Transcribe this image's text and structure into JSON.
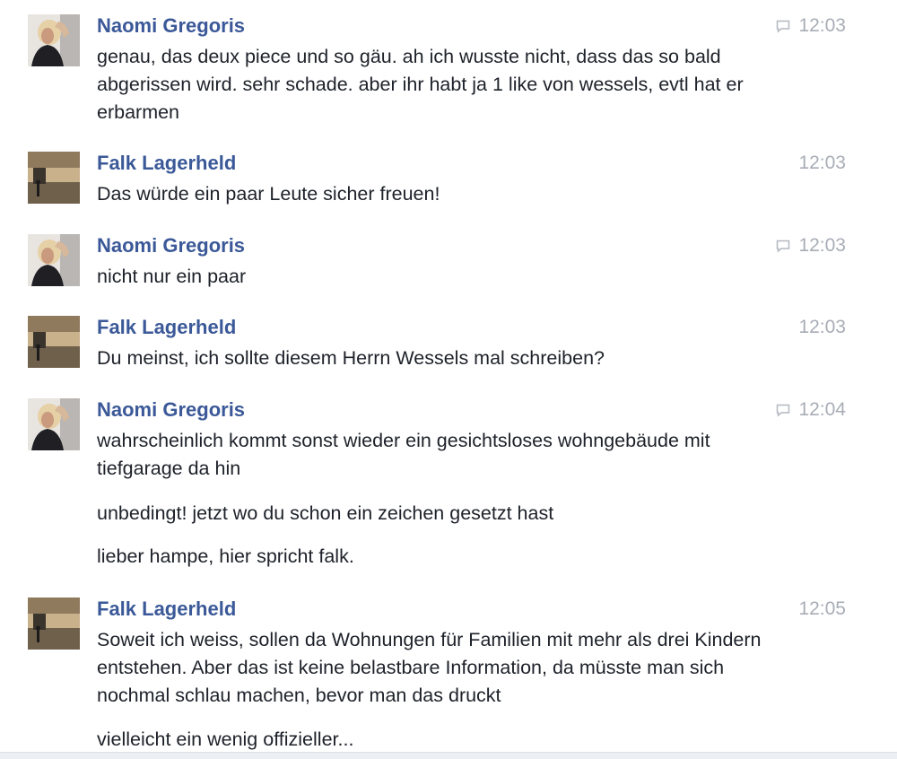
{
  "messages": [
    {
      "sender": "Naomi Gregoris",
      "time": "12:03",
      "has_comment_icon": true,
      "paragraphs": [
        "genau, das deux piece und so gäu. ah ich wusste nicht, dass das so bald abgerissen wird. sehr schade. aber ihr habt ja 1 like von wessels, evtl hat er erbarmen"
      ]
    },
    {
      "sender": "Falk Lagerheld",
      "time": "12:03",
      "has_comment_icon": false,
      "paragraphs": [
        "Das würde ein paar Leute sicher freuen!"
      ]
    },
    {
      "sender": "Naomi Gregoris",
      "time": "12:03",
      "has_comment_icon": true,
      "paragraphs": [
        "nicht nur ein paar"
      ]
    },
    {
      "sender": "Falk Lagerheld",
      "time": "12:03",
      "has_comment_icon": false,
      "paragraphs": [
        "Du meinst, ich sollte diesem Herrn Wessels mal schreiben?"
      ]
    },
    {
      "sender": "Naomi Gregoris",
      "time": "12:04",
      "has_comment_icon": true,
      "paragraphs": [
        "wahrscheinlich kommt sonst wieder ein gesichtsloses wohngebäude mit tiefgarage da hin",
        "unbedingt! jetzt wo du schon ein zeichen gesetzt hast",
        "lieber hampe, hier spricht falk."
      ]
    },
    {
      "sender": "Falk Lagerheld",
      "time": "12:05",
      "has_comment_icon": false,
      "paragraphs": [
        "Soweit ich weiss, sollen da Wohnungen für Familien mit mehr als drei Kindern entstehen. Aber das ist keine belastbare Information, da müsste man sich nochmal schlau machen, bevor man das druckt",
        "vielleicht ein wenig offizieller..."
      ]
    }
  ],
  "colors": {
    "sender": "#3b5998",
    "text": "#1d2129",
    "time": "#a8adb6"
  },
  "icons": {
    "naomi_avatar": "avatar-naomi-photo",
    "falk_avatar": "avatar-falk-photo",
    "comment": "comment-icon"
  }
}
